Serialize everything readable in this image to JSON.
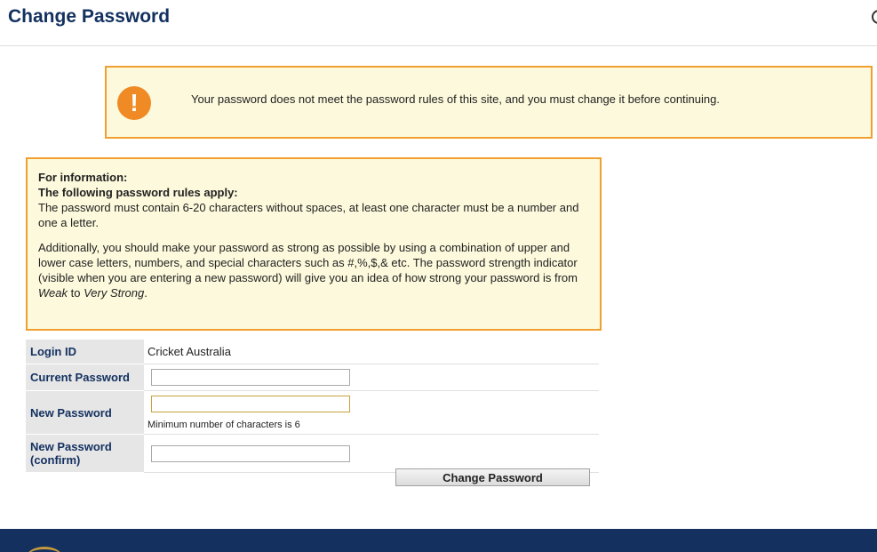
{
  "header": {
    "title": "Change Password"
  },
  "warning": {
    "icon": "exclamation-icon",
    "icon_glyph": "!",
    "message": "Your password does not meet the password rules of this site, and you must change it before continuing."
  },
  "info": {
    "heading1": "For information:",
    "heading2": "The following password rules apply:",
    "rule": "The password must contain 6-20 characters without spaces, at least one character must be a number and one a letter.",
    "additional_start": "Additionally, you should make your password as strong as possible by using a combination of upper and lower case letters, numbers, and special characters such as #,%,$,& etc. The password strength indicator (visible when you are entering a new password) will give you an idea of how strong your password is from ",
    "weak": "Weak",
    "to": " to ",
    "very_strong": "Very Strong",
    "end": "."
  },
  "form": {
    "login_id_label": "Login ID",
    "login_id_value": "Cricket Australia",
    "current_password_label": "Current Password",
    "current_password_value": "",
    "new_password_label": "New Password",
    "new_password_value": "",
    "new_password_hint": "Minimum number of characters is 6",
    "confirm_label": "New Password (confirm)",
    "confirm_value": "",
    "submit_label": "Change Password"
  },
  "colors": {
    "title": "#13305f",
    "box_background": "#fdf9dc",
    "box_border": "#f0a030",
    "warning_icon": "#f08a24",
    "footer": "#13305f"
  }
}
